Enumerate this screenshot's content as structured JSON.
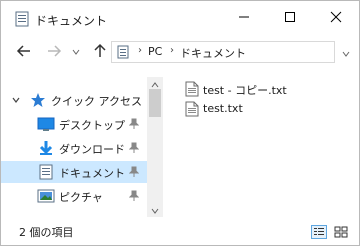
{
  "window": {
    "title": "ドキュメント",
    "controls": {
      "minimize": "minimize",
      "maximize": "maximize",
      "close": "close"
    }
  },
  "address": {
    "segments": [
      "PC",
      "ドキュメント"
    ]
  },
  "navpane": {
    "items": [
      {
        "label": "クイック アクセス",
        "icon": "star-icon",
        "pinned": false
      },
      {
        "label": "デスクトップ",
        "icon": "desktop-icon",
        "pinned": true
      },
      {
        "label": "ダウンロード",
        "icon": "download-icon",
        "pinned": true
      },
      {
        "label": "ドキュメント",
        "icon": "documents-icon",
        "pinned": true,
        "selected": true
      },
      {
        "label": "ピクチャ",
        "icon": "pictures-icon",
        "pinned": true
      }
    ]
  },
  "files": [
    {
      "name": "test - コピー.txt",
      "icon": "text-file-icon"
    },
    {
      "name": "test.txt",
      "icon": "text-file-icon"
    }
  ],
  "status": {
    "item_count": "2 個の項目",
    "view_mode": "details"
  },
  "colors": {
    "selected_bg": "#cce8ff",
    "accent": "#0078d7",
    "quick_access_star": "#2b7cd3"
  }
}
